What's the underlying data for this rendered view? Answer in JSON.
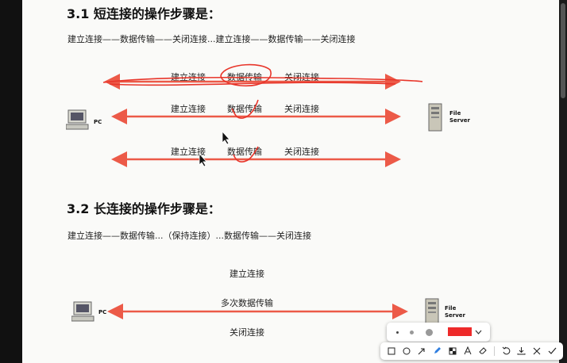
{
  "section1": {
    "heading": "3.1 短连接的操作步骤是：",
    "steps": "建立连接——数据传输——关闭连接...建立连接——数据传输——关闭连接",
    "rows": [
      {
        "establish": "建立连接",
        "transfer": "数据传输",
        "close": "关闭连接"
      },
      {
        "establish": "建立连接",
        "transfer": "数据传输",
        "close": "关闭连接"
      },
      {
        "establish": "建立连接",
        "transfer": "数据传输",
        "close": "关闭连接"
      }
    ],
    "pc_label": "PC",
    "server_label_1": "File",
    "server_label_2": "Server"
  },
  "section2": {
    "heading": "3.2 长连接的操作步骤是：",
    "steps": "建立连接——数据传输...（保持连接）...数据传输——关闭连接",
    "establish": "建立连接",
    "transfer": "多次数据传输",
    "close": "关闭连接",
    "pc_label": "PC",
    "server_label_1": "File",
    "server_label_2": "Server"
  },
  "annotation_toolbar": {
    "color": "#ee2a2a",
    "size_options": [
      "small-dot",
      "medium-dot",
      "large-dot"
    ],
    "tools": [
      "rectangle-icon",
      "ellipse-icon",
      "arrow-icon",
      "pen-icon",
      "mosaic-icon",
      "text-icon",
      "eraser-icon",
      "undo-icon",
      "download-icon",
      "close-icon",
      "confirm-icon"
    ]
  },
  "colors": {
    "arrow": "#ec5a48",
    "ink": "#e8352a"
  }
}
